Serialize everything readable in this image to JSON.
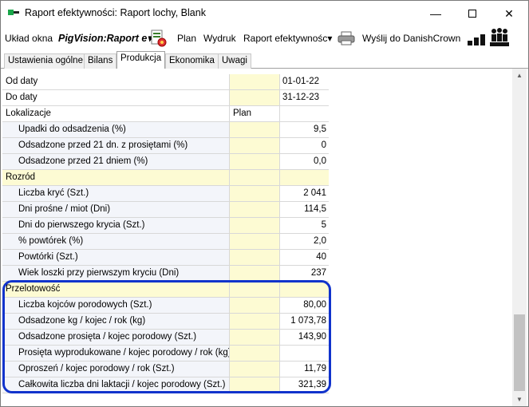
{
  "window": {
    "title": "Raport efektywności: Raport lochy, Blank",
    "minimize": "—",
    "close": "✕"
  },
  "toolbar": {
    "uklad_okna": "Układ okna",
    "pigvision": "PigVision:Raport e▾",
    "plan": "Plan",
    "wydruk": "Wydruk",
    "raport": "Raport efektywnośc▾",
    "wyslij": "Wyślij do DanishCrown"
  },
  "tabs": [
    "Ustawienia ogólne",
    "Bilans",
    "Produkcja",
    "Ekonomika",
    "Uwagi"
  ],
  "colors": {
    "plan_bg": "#fdfbd3",
    "highlight": "#1133cc",
    "sub_bg": "#f3f5fa"
  },
  "rows": [
    {
      "label": "Od daty",
      "plan": "",
      "value": "01-01-22"
    },
    {
      "label": "Do daty",
      "plan": "",
      "value": "31-12-23"
    },
    {
      "label": "Lokalizacje",
      "plan": "Plan",
      "value": ""
    },
    {
      "label": "Upadki do odsadzenia (%)",
      "plan": "",
      "value": "9,5"
    },
    {
      "label": "Odsadzone przed 21 dn. z prosiętami (%)",
      "plan": "",
      "value": "0"
    },
    {
      "label": "Odsadzone przed 21 dniem (%)",
      "plan": "",
      "value": "0,0"
    },
    {
      "label": "Rozród",
      "plan": "",
      "value": ""
    },
    {
      "label": "Liczba kryć (Szt.)",
      "plan": "",
      "value": "2 041"
    },
    {
      "label": "Dni prośne / miot (Dni)",
      "plan": "",
      "value": "114,5"
    },
    {
      "label": "Dni do pierwszego krycia (Szt.)",
      "plan": "",
      "value": "5"
    },
    {
      "label": "% powtórek (%)",
      "plan": "",
      "value": "2,0"
    },
    {
      "label": "Powtórki (Szt.)",
      "plan": "",
      "value": "40"
    },
    {
      "label": "Wiek loszki przy pierwszym kryciu (Dni)",
      "plan": "",
      "value": "237"
    },
    {
      "label": "Przelotowość",
      "plan": "",
      "value": ""
    },
    {
      "label": "Liczba kojców porodowych (Szt.)",
      "plan": "",
      "value": "80,00"
    },
    {
      "label": "Odsadzone kg / kojec / rok (kg)",
      "plan": "",
      "value": "1 073,78"
    },
    {
      "label": "Odsadzone prosięta / kojec porodowy (Szt.)",
      "plan": "",
      "value": "143,90"
    },
    {
      "label": "Prosięta wyprodukowane / kojec porodowy / rok (kg)",
      "plan": "",
      "value": ""
    },
    {
      "label": "Oproszeń / kojec porodowy / rok (Szt.)",
      "plan": "",
      "value": "11,79"
    },
    {
      "label": "Całkowita liczba dni laktacji / kojec porodowy (Szt.)",
      "plan": "",
      "value": "321,39"
    }
  ]
}
